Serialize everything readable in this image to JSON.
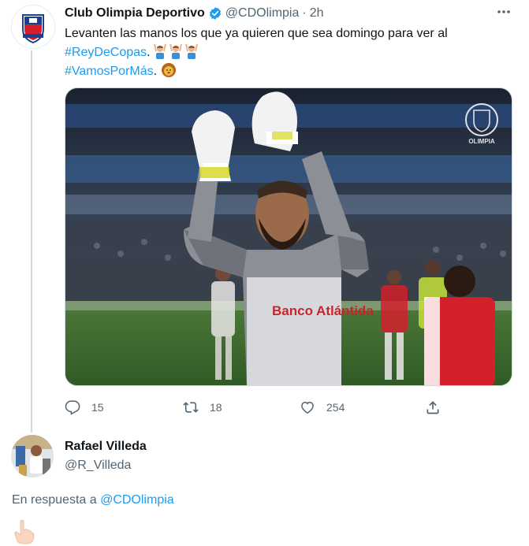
{
  "tweet": {
    "display_name": "Club Olimpia Deportivo",
    "handle": "@CDOlimpia",
    "separator": "·",
    "time": "2h",
    "text_line1": "Levanten las manos los que ya quieren que sea domingo para ver al",
    "hashtag1": "#ReyDeCopas",
    "after_hashtag1": ". ",
    "hashtag2": "#VamosPorMás",
    "after_hashtag2": ". ",
    "media_watermark": "OLIMPIA",
    "jersey_sponsor": "Banco Atlántida",
    "actions": {
      "replies": "15",
      "retweets": "18",
      "likes": "254"
    },
    "icons": [
      "verified-icon",
      "more-icon",
      "reply-icon",
      "retweet-icon",
      "like-icon",
      "share-icon"
    ]
  },
  "reply": {
    "display_name": "Rafael Villeda",
    "handle": "@R_Villeda",
    "reply_prefix": "En respuesta a ",
    "reply_mention": "@CDOlimpia"
  },
  "colors": {
    "link": "#1d9bf0",
    "secondary_text": "#536471",
    "verified": "#1d9bf0",
    "olimpia_red": "#d3202b",
    "olimpia_blue": "#1d3f8f"
  }
}
